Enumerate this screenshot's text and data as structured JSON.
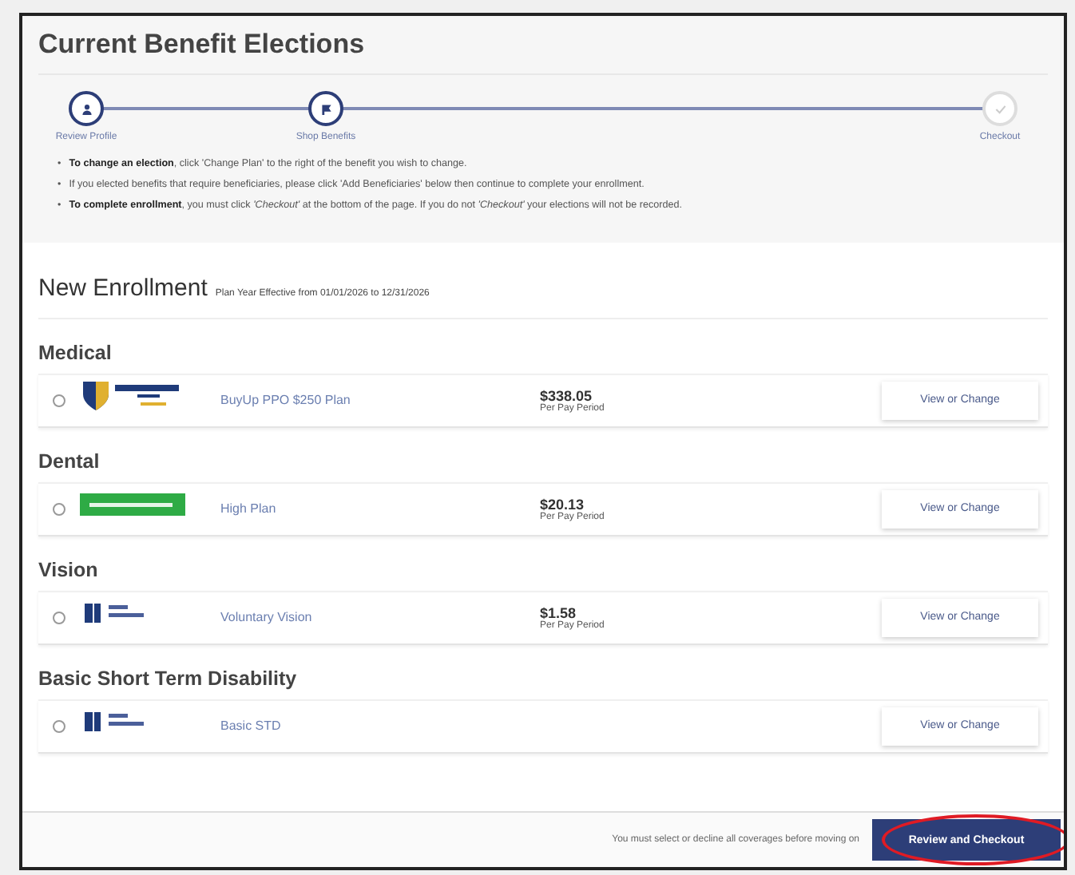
{
  "title": "Current Benefit Elections",
  "steps": [
    {
      "label": "Review Profile",
      "active": true,
      "kind": "person"
    },
    {
      "label": "Shop Benefits",
      "active": true,
      "kind": "flag"
    },
    {
      "label": "Checkout",
      "active": false,
      "kind": "check"
    }
  ],
  "instructions": [
    {
      "bullet": "•",
      "text": "**To change an election**, click 'Change Plan' to the right of the benefit you wish to change."
    },
    {
      "bullet": "•",
      "text": "If you elected benefits that require beneficiaries, please click 'Add Beneficiaries' below then continue to complete your enrollment."
    },
    {
      "bullet": "•",
      "text": "**To complete enrollment**, you must click *'Checkout'* at the bottom of the page. If you do not *'Checkout'* your elections will not be recorded."
    }
  ],
  "enrollment": {
    "title": "New Enrollment",
    "subtitle": "Plan Year Effective from 01/01/2026 to 12/31/2026"
  },
  "sections": [
    {
      "heading": "Medical",
      "plan": {
        "kind": "shield",
        "name": "BuyUp PPO $250 Plan",
        "price": "$338.05",
        "period": "Per Pay Period",
        "action": "View or Change"
      }
    },
    {
      "heading": "Dental",
      "plan": {
        "kind": "badge",
        "name": "High Plan",
        "price": "$20.13",
        "period": "Per Pay Period",
        "action": "View or Change"
      }
    },
    {
      "heading": "Vision",
      "plan": {
        "kind": "bars",
        "name": "Voluntary Vision",
        "price": "$1.58",
        "period": "Per Pay Period",
        "action": "View or Change"
      }
    },
    {
      "heading": "Basic Short Term Disability",
      "plan": {
        "kind": "bars",
        "name": "Basic STD",
        "action": "View or Change"
      }
    }
  ],
  "footer": {
    "note": "You must select or decline all coverages before moving on",
    "button": "Review and Checkout",
    "highlighted": true
  }
}
